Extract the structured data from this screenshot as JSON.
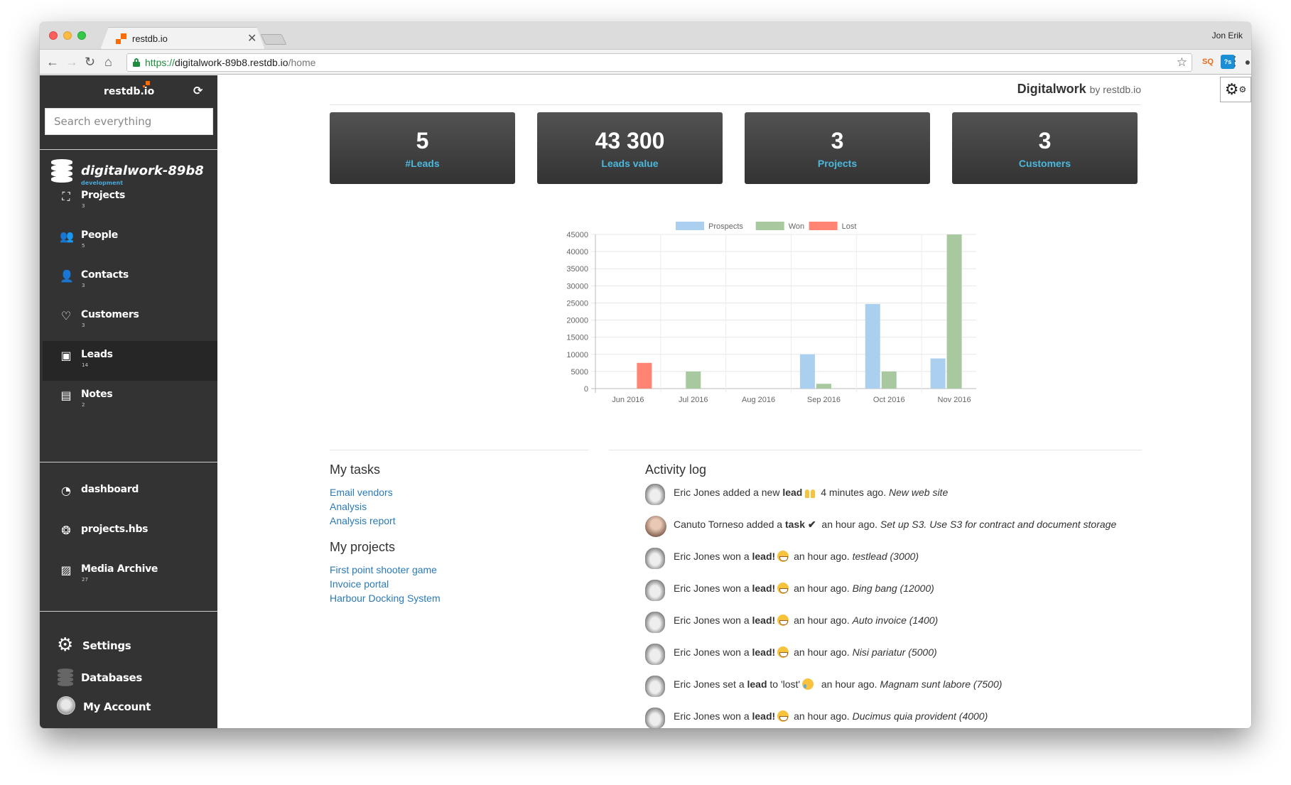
{
  "browser": {
    "tab_title": "restdb.io",
    "profile_name": "Jon Erik",
    "url_scheme": "https://",
    "url_host": "digitalwork-89b8.restdb.io",
    "url_path": "/home",
    "extensions": [
      "sq-extension-icon",
      "stackoverflow-extension-icon",
      "evernote-extension-icon",
      "speedometer-extension-icon"
    ]
  },
  "sidebar": {
    "brand": "restdb.io",
    "search_placeholder": "Search everything",
    "database_name": "digitalwork-89b8",
    "database_env": "development",
    "collections": [
      {
        "label": "Projects",
        "count": "3",
        "icon": "projects-icon"
      },
      {
        "label": "People",
        "count": "5",
        "icon": "people-icon"
      },
      {
        "label": "Contacts",
        "count": "3",
        "icon": "contact-icon"
      },
      {
        "label": "Customers",
        "count": "3",
        "icon": "heart-icon"
      },
      {
        "label": "Leads",
        "count": "14",
        "icon": "money-icon",
        "active": true
      },
      {
        "label": "Notes",
        "count": "2",
        "icon": "note-icon"
      }
    ],
    "pages": [
      {
        "label": "dashboard",
        "count": "",
        "icon": "dashboard-icon"
      },
      {
        "label": "projects.hbs",
        "count": "",
        "icon": "lifebuoy-icon"
      },
      {
        "label": "Media Archive",
        "count": "27",
        "icon": "image-icon"
      }
    ],
    "bottom": {
      "settings": "Settings",
      "databases": "Databases",
      "account": "My Account"
    }
  },
  "header": {
    "app_name": "Digitalwork",
    "by_text": "by restdb.io"
  },
  "stats": [
    {
      "value": "5",
      "label": "#Leads"
    },
    {
      "value": "43 300",
      "label": "Leads value"
    },
    {
      "value": "3",
      "label": "Projects"
    },
    {
      "value": "3",
      "label": "Customers"
    }
  ],
  "chart_data": {
    "type": "bar",
    "title": "",
    "xlabel": "",
    "ylabel": "",
    "categories": [
      "Jun 2016",
      "Jul 2016",
      "Aug 2016",
      "Sep 2016",
      "Oct 2016",
      "Nov 2016"
    ],
    "series": [
      {
        "name": "Prospects",
        "color": "#abcfee",
        "values": [
          0,
          0,
          0,
          10000,
          24700,
          8800
        ]
      },
      {
        "name": "Won",
        "color": "#a8c8a0",
        "values": [
          0,
          5000,
          0,
          1400,
          5000,
          45000
        ]
      },
      {
        "name": "Lost",
        "color": "#ff8473",
        "values": [
          7500,
          0,
          0,
          0,
          0,
          0
        ]
      }
    ],
    "ylim": [
      0,
      45000
    ],
    "yticks": [
      0,
      5000,
      10000,
      15000,
      20000,
      25000,
      30000,
      35000,
      40000,
      45000
    ],
    "grid": true,
    "legend_position": "top"
  },
  "tasks": {
    "title": "My tasks",
    "items": [
      "Email vendors",
      "Analysis",
      "Analysis report"
    ]
  },
  "projects": {
    "title": "My projects",
    "items": [
      "First point shooter game",
      "Invoice portal",
      "Harbour Docking System"
    ]
  },
  "activity": {
    "title": "Activity log",
    "items": [
      {
        "user": "Eric Jones",
        "pre": " added a new ",
        "bold": "lead",
        "post": "",
        "emoji": "hands",
        "time": " 4 minutes ago. ",
        "detail": "New web site"
      },
      {
        "user": "Canuto Torneso",
        "pre": " added a ",
        "bold": "task ✔",
        "post": "",
        "emoji": "",
        "time": "  an hour ago. ",
        "detail": "Set up S3. Use S3 for contract and document storage"
      },
      {
        "user": "Eric Jones",
        "pre": " won a ",
        "bold": "lead!",
        "post": "",
        "emoji": "happy",
        "time": " an hour ago. ",
        "detail": "testlead (3000)"
      },
      {
        "user": "Eric Jones",
        "pre": " won a ",
        "bold": "lead!",
        "post": "",
        "emoji": "happy",
        "time": " an hour ago. ",
        "detail": "Bing bang (12000)"
      },
      {
        "user": "Eric Jones",
        "pre": " won a ",
        "bold": "lead!",
        "post": "",
        "emoji": "happy",
        "time": " an hour ago. ",
        "detail": "Auto invoice (1400)"
      },
      {
        "user": "Eric Jones",
        "pre": " won a ",
        "bold": "lead!",
        "post": "",
        "emoji": "happy",
        "time": " an hour ago. ",
        "detail": "Nisi pariatur (5000)"
      },
      {
        "user": "Eric Jones",
        "pre": " set a ",
        "bold": "lead",
        "post": " to 'lost'",
        "emoji": "sad",
        "time": "  an hour ago. ",
        "detail": "Magnam sunt labore (7500)"
      },
      {
        "user": "Eric Jones",
        "pre": " won a ",
        "bold": "lead!",
        "post": "",
        "emoji": "happy",
        "time": " an hour ago. ",
        "detail": "Ducimus quia provident (4000)"
      }
    ]
  }
}
